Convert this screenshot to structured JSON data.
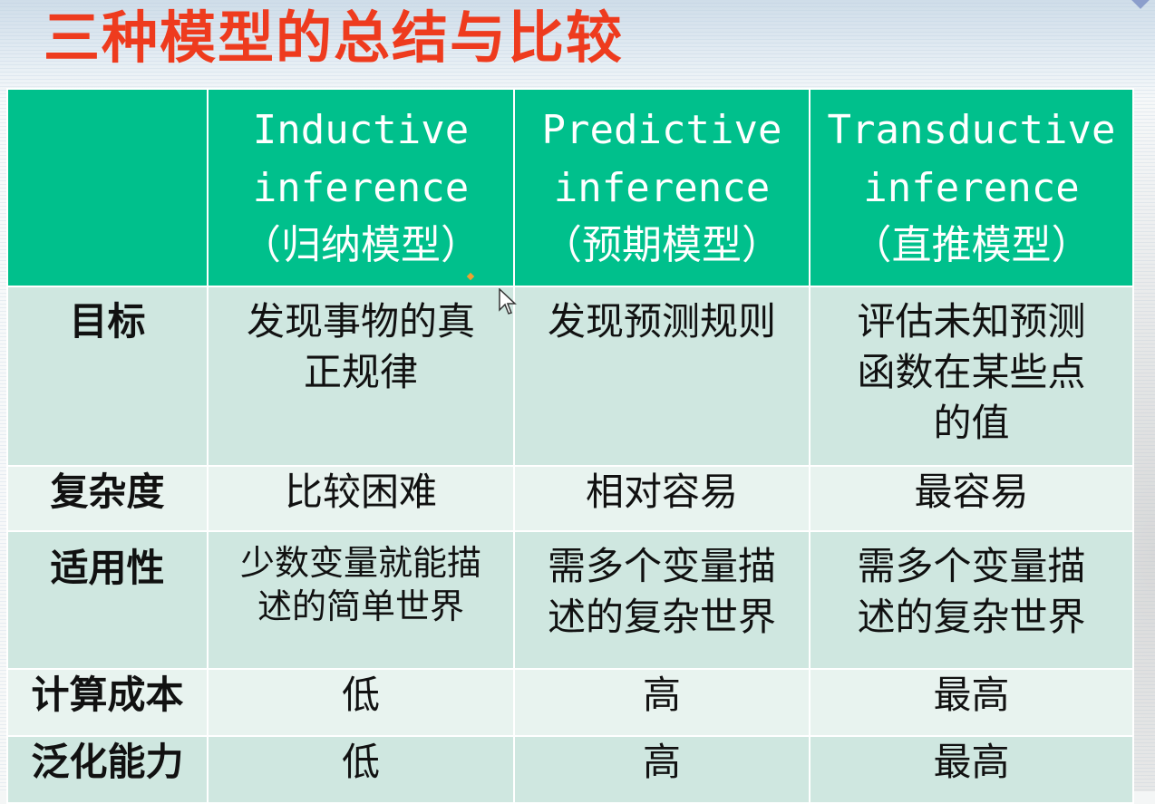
{
  "slide": {
    "title": "三种模型的总结与比较",
    "accent_color": "#ee3b1e",
    "header_color": "#00c08c"
  },
  "table": {
    "columns": [
      {
        "en_line1": "Inductive",
        "en_line2": "inference",
        "zh": "（归纳模型）"
      },
      {
        "en_line1": "Predictive",
        "en_line2": "inference",
        "zh": "（预期模型）"
      },
      {
        "en_line1": "Transductive",
        "en_line2": "inference",
        "zh": "（直推模型）"
      }
    ],
    "rows": [
      {
        "label": "目标",
        "cells": [
          [
            "发现事物的真",
            "正规律"
          ],
          [
            "发现预测规则"
          ],
          [
            "评估未知预测",
            "函数在某些点",
            "的值"
          ]
        ]
      },
      {
        "label": "复杂度",
        "cells": [
          [
            "比较困难"
          ],
          [
            "相对容易"
          ],
          [
            "最容易"
          ]
        ]
      },
      {
        "label": "适用性",
        "cells": [
          [
            "少数变量就能描",
            "述的简单世界"
          ],
          [
            "需多个变量描",
            "述的复杂世界"
          ],
          [
            "需多个变量描",
            "述的复杂世界"
          ]
        ]
      },
      {
        "label": "计算成本",
        "cells": [
          [
            "低"
          ],
          [
            "高"
          ],
          [
            "最高"
          ]
        ]
      },
      {
        "label": "泛化能力",
        "cells": [
          [
            "低"
          ],
          [
            "高"
          ],
          [
            "最高"
          ]
        ]
      }
    ]
  },
  "icons": {
    "cursor": "mouse-pointer-icon",
    "logo": "logo-icon"
  }
}
